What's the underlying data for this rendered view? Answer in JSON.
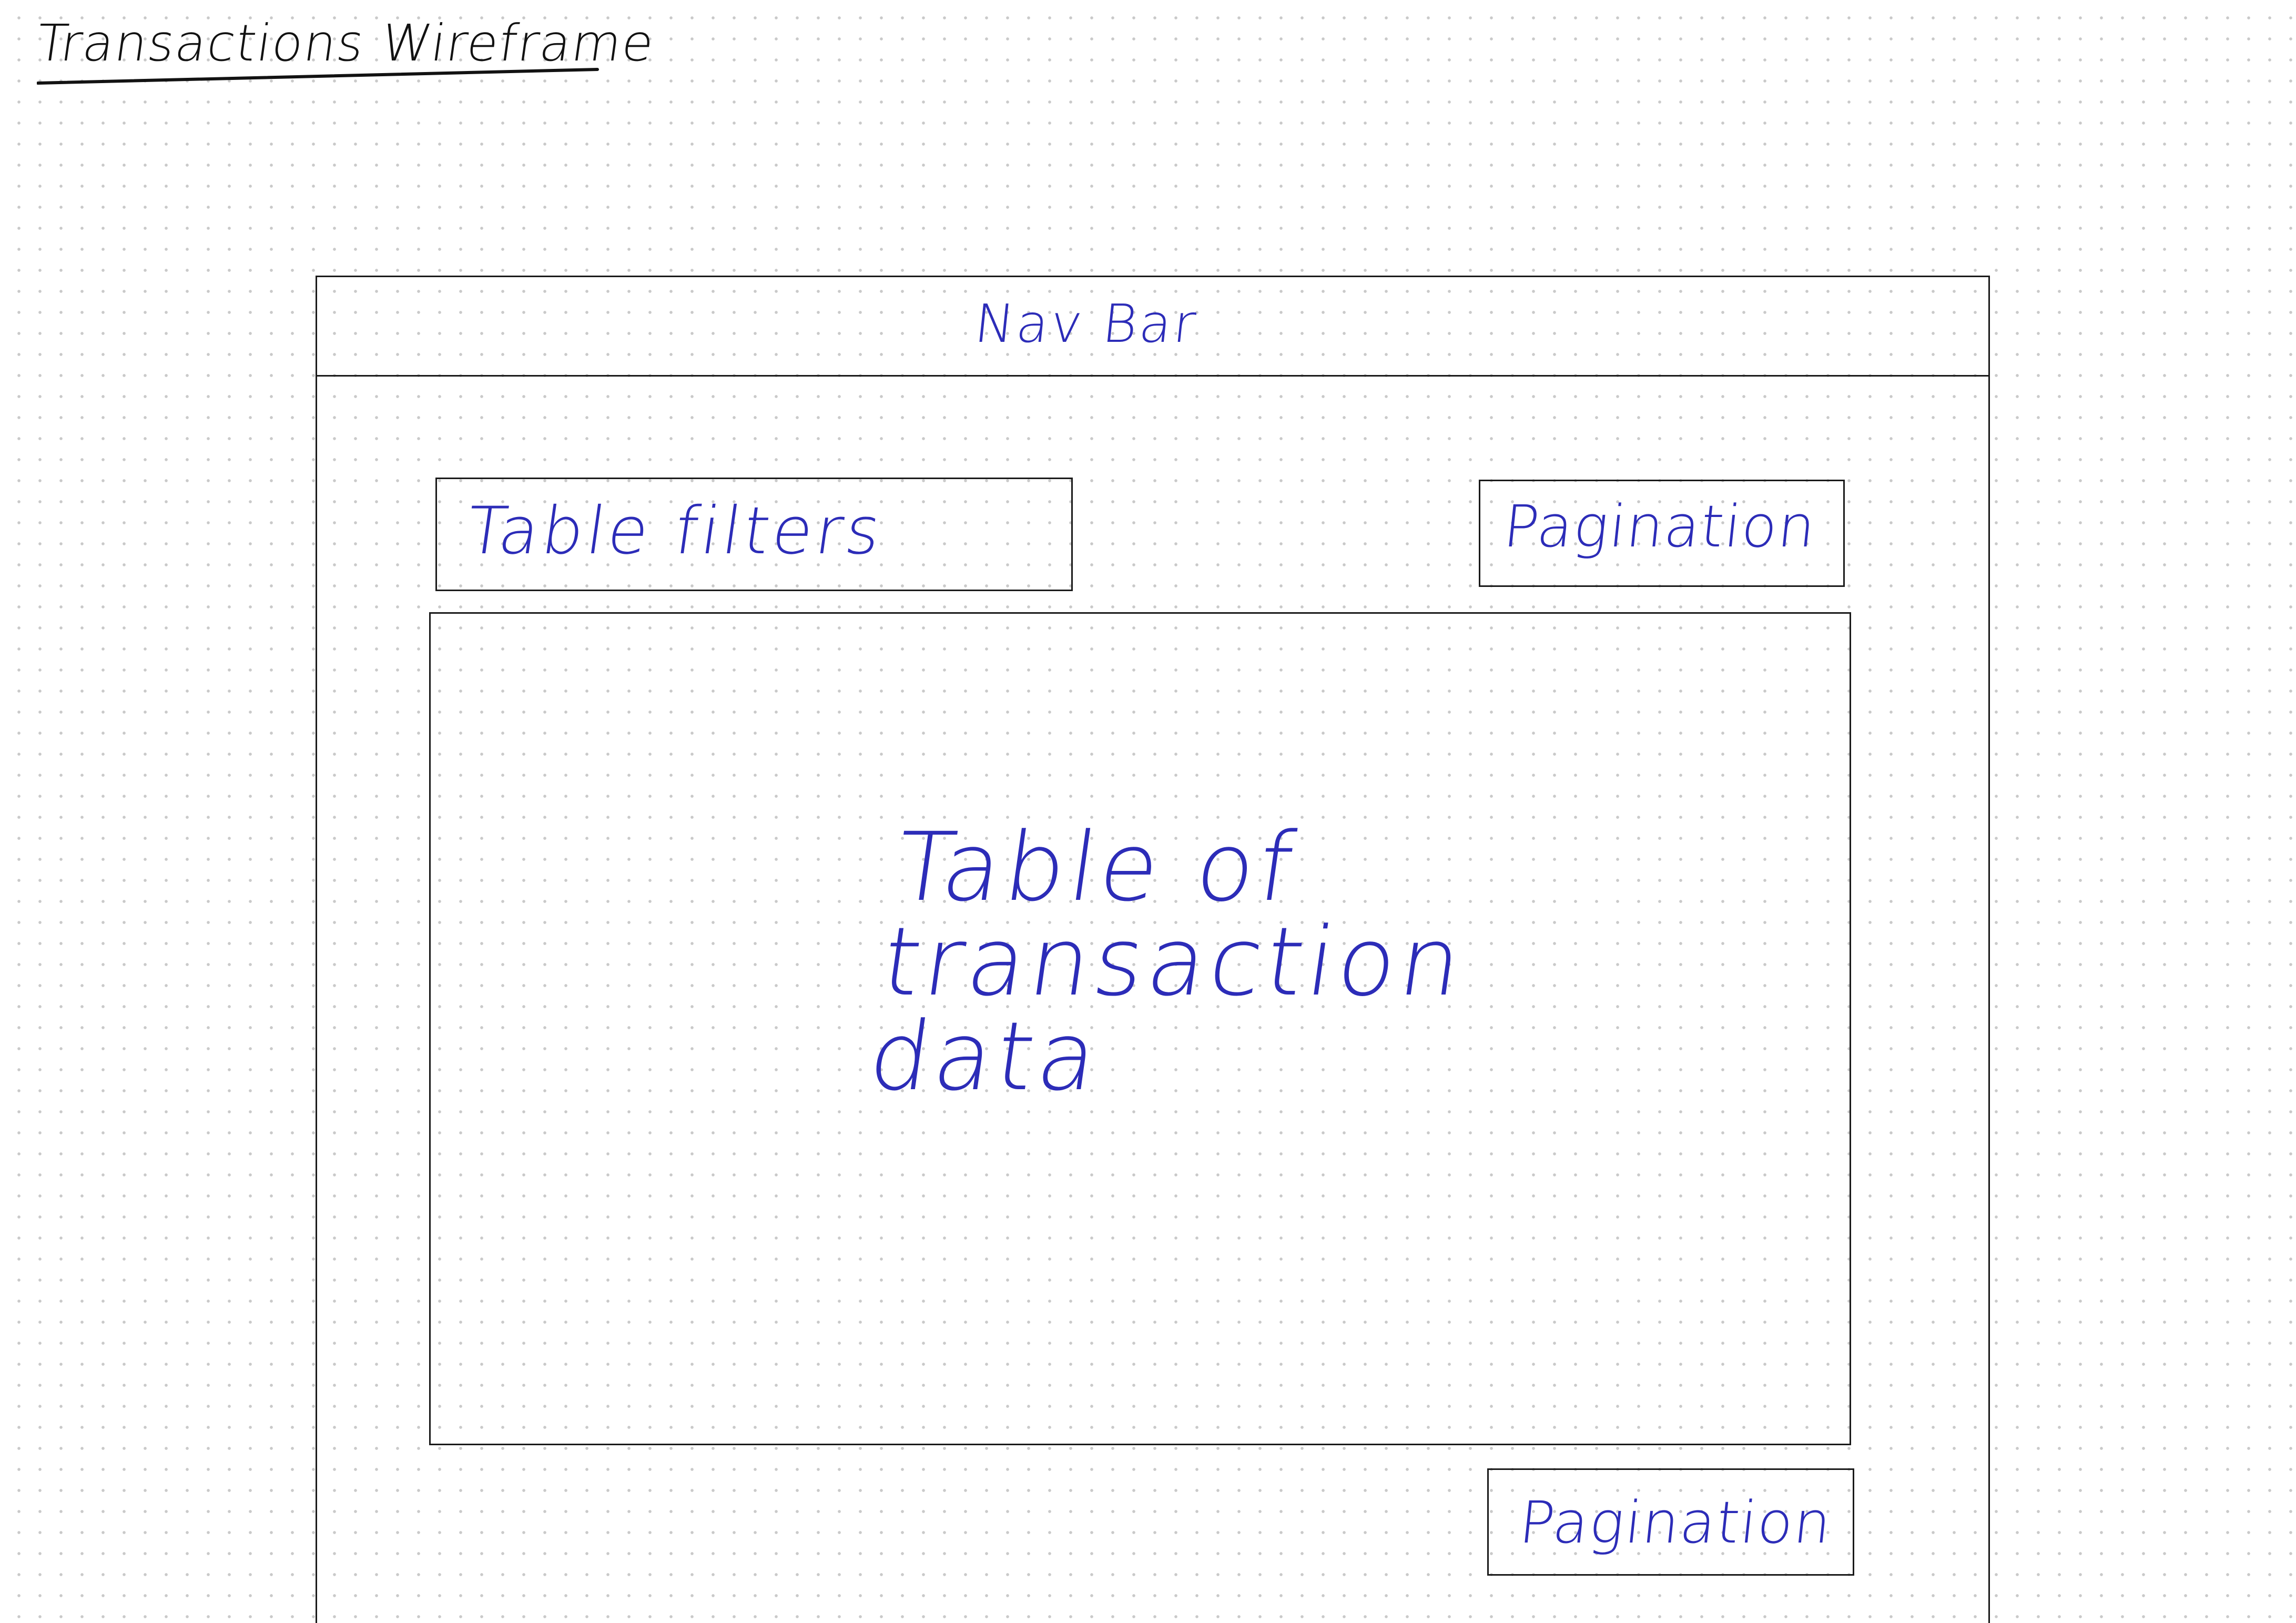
{
  "title": "Transactions Wireframe",
  "wireframe": {
    "nav_bar": {
      "label": "Nav Bar"
    },
    "table_filters": {
      "label": "Table filters"
    },
    "pagination_top": {
      "label": "Pagination"
    },
    "table": {
      "label": "Table of\ntransaction\ndata"
    },
    "pagination_bottom": {
      "label": "Pagination"
    }
  },
  "colors": {
    "ink_black": "#1a1a1a",
    "ink_blue": "#2c2cb8",
    "dot_grid": "#c9c9c9"
  }
}
